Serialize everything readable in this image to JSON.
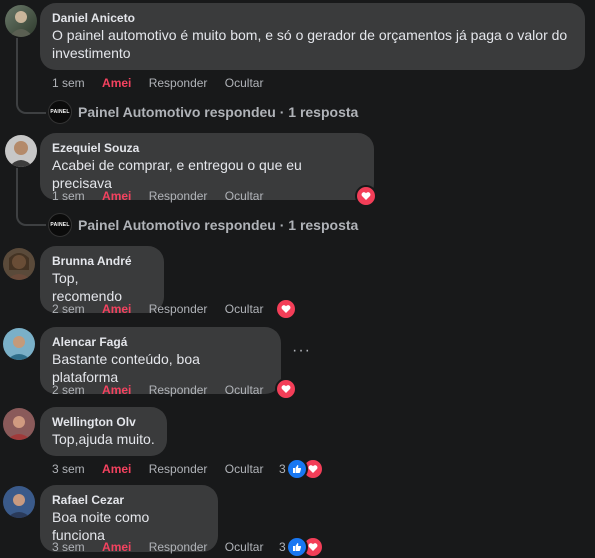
{
  "colors": {
    "background": "#18191a",
    "bubble": "#3a3b3c",
    "amei": "#f3425f",
    "heart": "#f33e58",
    "like": "#1877f2"
  },
  "comments": [
    {
      "author": "Daniel Aniceto",
      "text": "O painel automotivo é muito bom, e só o gerador de orçamentos já paga o valor do investimento",
      "time": "1 sem",
      "like": "Amei",
      "reply": "Responder",
      "hide": "Ocultar",
      "reply_link": "Painel Automotivo respondeu · 1 resposta",
      "avatar_icon": "user-avatar"
    },
    {
      "author": "Ezequiel Souza",
      "text": "Acabei de comprar, e entregou o que eu precisava",
      "time": "1 sem",
      "like": "Amei",
      "reply": "Responder",
      "hide": "Ocultar",
      "reply_link": "Painel Automotivo respondeu · 1 resposta",
      "reaction": "heart-icon",
      "avatar_icon": "user-avatar"
    },
    {
      "author": "Brunna André",
      "text": "Top, recomendo",
      "time": "2 sem",
      "like": "Amei",
      "reply": "Responder",
      "hide": "Ocultar",
      "reaction": "heart-icon",
      "avatar_icon": "user-avatar"
    },
    {
      "author": "Alencar Fagá",
      "text": "Bastante conteúdo, boa plataforma",
      "time": "2 sem",
      "like": "Amei",
      "reply": "Responder",
      "hide": "Ocultar",
      "reaction": "heart-icon",
      "more": "···",
      "avatar_icon": "user-avatar"
    },
    {
      "author": "Wellington Olv",
      "text": "Top,ajuda muito.",
      "time": "3 sem",
      "like": "Amei",
      "reply": "Responder",
      "hide": "Ocultar",
      "reaction_count": "3",
      "avatar_icon": "user-avatar"
    },
    {
      "author": "Rafael Cezar",
      "text": "Boa noite como funciona",
      "time": "3 sem",
      "like": "Amei",
      "reply": "Responder",
      "hide": "Ocultar",
      "reaction_count": "3",
      "avatar_icon": "user-avatar"
    }
  ],
  "reply_logo_text": "PAINEL"
}
